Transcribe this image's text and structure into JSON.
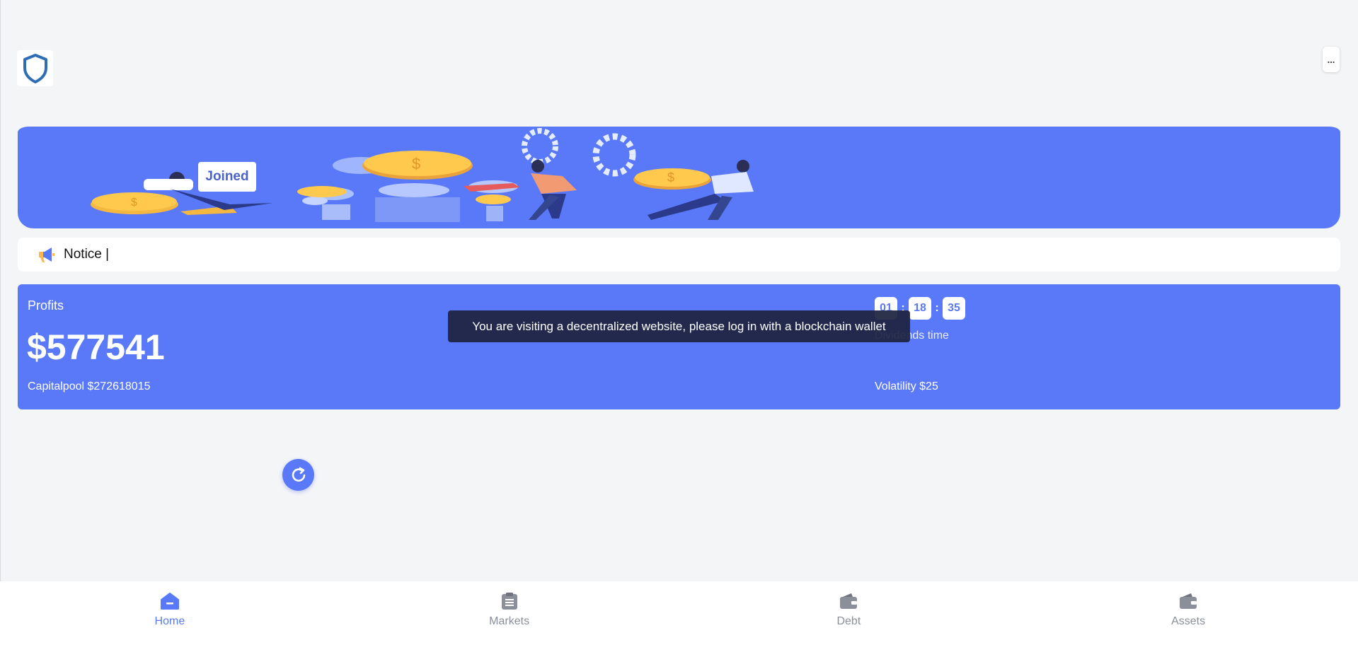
{
  "banner": {
    "joined_label": "Joined"
  },
  "notice": {
    "text": "Notice |"
  },
  "profits": {
    "label": "Profits",
    "amount": "$577541",
    "capitalpool": "Capitalpool $272618015",
    "volatility": "Volatility $25",
    "dividends_label": "Dividends time",
    "timer": {
      "hours": "01",
      "minutes": "18",
      "seconds": "35",
      "separator": ":"
    }
  },
  "toast": {
    "message": "You are visiting a decentralized website, please log in with a blockchain wallet"
  },
  "header": {
    "more_label": "..."
  },
  "nav": {
    "items": [
      {
        "label": "Home",
        "icon": "home-icon",
        "active": true
      },
      {
        "label": "Markets",
        "icon": "clipboard-icon",
        "active": false
      },
      {
        "label": "Debt",
        "icon": "wallet-icon",
        "active": false
      },
      {
        "label": "Assets",
        "icon": "wallet-icon",
        "active": false
      }
    ]
  },
  "colors": {
    "accent": "#5a79f8",
    "toast_bg": "#1e2440",
    "page_bg": "#f4f5f7",
    "icon_gray": "#8a8f99"
  }
}
